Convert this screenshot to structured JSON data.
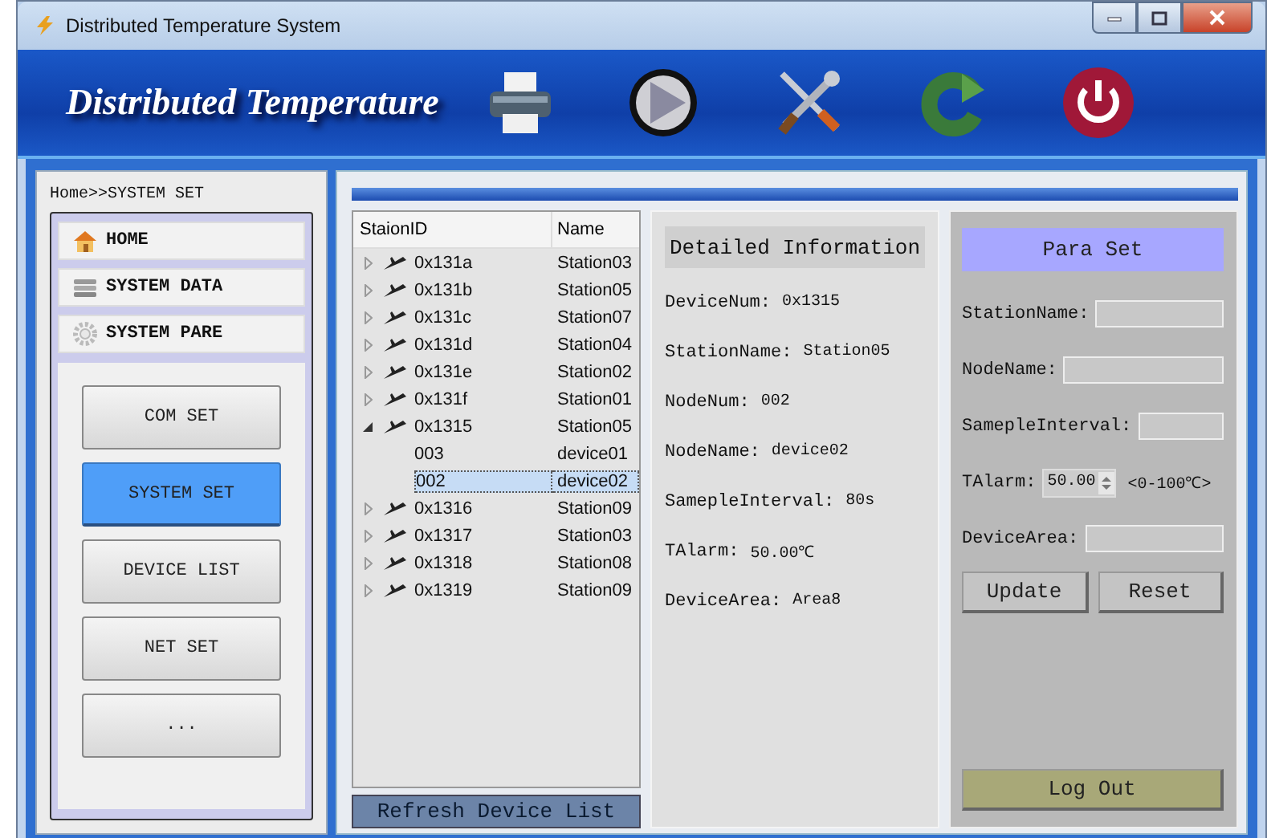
{
  "window": {
    "title": "Distributed Temperature System"
  },
  "header": {
    "title": "Distributed Temperature"
  },
  "breadcrumb": "Home>>SYSTEM SET",
  "nav": {
    "sections": [
      {
        "label": "HOME"
      },
      {
        "label": "SYSTEM DATA"
      },
      {
        "label": "SYSTEM PARE"
      }
    ],
    "buttons": [
      {
        "label": "COM SET",
        "selected": false
      },
      {
        "label": "SYSTEM SET",
        "selected": true
      },
      {
        "label": "DEVICE LIST",
        "selected": false
      },
      {
        "label": "NET SET",
        "selected": false
      },
      {
        "label": "...",
        "selected": false
      }
    ]
  },
  "tree": {
    "columns": [
      "StaionID",
      "Name"
    ],
    "rows": [
      {
        "id": "0x131a",
        "name": "Station03",
        "expanded": false,
        "selected": false
      },
      {
        "id": "0x131b",
        "name": "Station05",
        "expanded": false,
        "selected": false
      },
      {
        "id": "0x131c",
        "name": "Station07",
        "expanded": false,
        "selected": false
      },
      {
        "id": "0x131d",
        "name": "Station04",
        "expanded": false,
        "selected": false
      },
      {
        "id": "0x131e",
        "name": "Station02",
        "expanded": false,
        "selected": false
      },
      {
        "id": "0x131f",
        "name": "Station01",
        "expanded": false,
        "selected": false
      },
      {
        "id": "0x1315",
        "name": "Station05",
        "expanded": true,
        "selected": false,
        "children": [
          {
            "id": "003",
            "name": "device01",
            "selected": false
          },
          {
            "id": "002",
            "name": "device02",
            "selected": true
          }
        ]
      },
      {
        "id": "0x1316",
        "name": "Station09",
        "expanded": false,
        "selected": false
      },
      {
        "id": "0x1317",
        "name": "Station03",
        "expanded": false,
        "selected": false
      },
      {
        "id": "0x1318",
        "name": "Station08",
        "expanded": false,
        "selected": false
      },
      {
        "id": "0x1319",
        "name": "Station09",
        "expanded": false,
        "selected": false
      }
    ],
    "refresh_button": "Refresh Device List"
  },
  "detail": {
    "title": "Detailed Information",
    "fields": [
      {
        "label": "DeviceNum:",
        "value": "0x1315"
      },
      {
        "label": "StationName:",
        "value": "Station05"
      },
      {
        "label": "NodeNum:",
        "value": "002"
      },
      {
        "label": "NodeName:",
        "value": "device02"
      },
      {
        "label": "SamepleInterval:",
        "value": "80s"
      },
      {
        "label": "TAlarm:",
        "value": "50.00℃"
      },
      {
        "label": "DeviceArea:",
        "value": "Area8"
      }
    ]
  },
  "para": {
    "title": "Para Set",
    "fields": [
      {
        "label": "StationName:",
        "kind": "text"
      },
      {
        "label": "NodeName:",
        "kind": "text"
      },
      {
        "label": "SamepleInterval:",
        "kind": "text"
      },
      {
        "label": "TAlarm:",
        "kind": "spin",
        "value": "50.00",
        "hint": "<0-100℃>"
      },
      {
        "label": "DeviceArea:",
        "kind": "text"
      }
    ],
    "buttons": [
      "Update",
      "Reset"
    ],
    "logout": "Log Out"
  }
}
